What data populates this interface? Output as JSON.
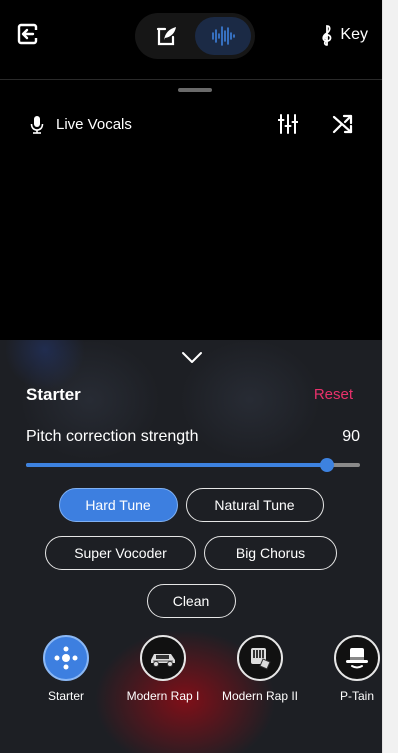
{
  "topbar": {
    "exit_icon": "exit-icon",
    "modes": [
      {
        "icon": "quill-pen-icon",
        "active": false
      },
      {
        "icon": "waveform-icon",
        "active": true
      }
    ],
    "key_label": "Key",
    "key_icon": "treble-clef-icon"
  },
  "track": {
    "label": "Live Vocals",
    "icons": [
      "microphone-icon",
      "mixer-sliders-icon",
      "shuffle-icon"
    ]
  },
  "panel": {
    "title": "Starter",
    "reset_label": "Reset",
    "strength_label": "Pitch correction strength",
    "strength_value": "90",
    "strength_fraction": 0.9,
    "chips": [
      {
        "label": "Hard Tune",
        "active": true
      },
      {
        "label": "Natural Tune",
        "active": false
      },
      {
        "label": "Super Vocoder",
        "active": false
      },
      {
        "label": "Big Chorus",
        "active": false
      },
      {
        "label": "Clean",
        "active": false
      }
    ],
    "presets": [
      {
        "label": "Starter",
        "icon": "dots-cross-icon",
        "active": true
      },
      {
        "label": "Modern Rap I",
        "icon": "car-icon",
        "active": false
      },
      {
        "label": "Modern Rap II",
        "icon": "sticker-icon",
        "active": false
      },
      {
        "label": "P-Tain",
        "icon": "top-hat-icon",
        "active": false
      }
    ]
  },
  "colors": {
    "accent": "#3d7fe0",
    "reset": "#e8316b",
    "panel_bg": "#1d1f24",
    "background": "#000000"
  }
}
